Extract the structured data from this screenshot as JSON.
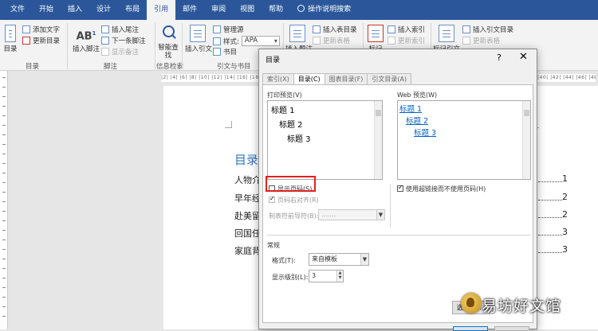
{
  "ribbon_tabs": [
    "文件",
    "开始",
    "插入",
    "设计",
    "布局",
    "引用",
    "邮件",
    "审阅",
    "视图",
    "帮助"
  ],
  "active_tab_index": 5,
  "tell_me": "操作说明搜索",
  "ribbon": {
    "toc_button": "目录",
    "add_text": "添加文字",
    "update_toc": "更新目录",
    "group_toc": "目录",
    "insert_footnote": "插入脚注",
    "insert_endnote": "插入尾注",
    "next_footnote": "下一条脚注",
    "show_notes": "显示备注",
    "group_footnotes": "脚注",
    "smart_lookup": "智能查找",
    "group_research": "信息检索",
    "insert_citation": "插入引文",
    "manage_sources": "管理源",
    "style_label": "样式:",
    "style_value": "APA",
    "bibliography": "书目",
    "group_citations": "引文与书目",
    "insert_caption": "插入题注",
    "insert_table_of_figures": "插入表目录",
    "update_table": "更新表格",
    "mark_entry": "标记",
    "insert_index": "插入索引",
    "update_index": "更新索引",
    "mark_citation": "标记引文",
    "insert_table_of_authorities": "插入引文目录",
    "update_table2": "更新表格"
  },
  "ruler_text": "|2| |4| |6| |8| |10| |12| |14| |16| |18|",
  "ruler_text_right": "|40| |42| |44| |46| |48|",
  "document": {
    "toc_title": "目录",
    "entries": [
      {
        "text": "人物介",
        "page": "1"
      },
      {
        "text": "早年经",
        "page": "2"
      },
      {
        "text": "赴美留",
        "page": "2"
      },
      {
        "text": "回国任",
        "page": "3"
      },
      {
        "text": "家庭背",
        "page": "3"
      }
    ]
  },
  "dialog": {
    "title": "目录",
    "help": "?",
    "close": "✕",
    "tabs": [
      "索引(X)",
      "目录(C)",
      "图表目录(F)",
      "引文目录(A)"
    ],
    "active_tab_index": 1,
    "print_preview_label": "打印预览(V)",
    "print_preview_items": [
      "标题 1",
      "标题 2",
      "标题 3"
    ],
    "web_preview_label": "Web 预览(W)",
    "web_preview_items": [
      "标题 1",
      "标题 2",
      "标题 3"
    ],
    "show_page_numbers": "显示页码(S)",
    "show_page_numbers_checked": false,
    "right_align": "页码右对齐(R)",
    "tab_leader_label": "制表符前导符(B):",
    "tab_leader_value": ".......",
    "use_hyperlinks": "使用超链接而不使用页码(H)",
    "use_hyperlinks_checked": true,
    "general_label": "常规",
    "formats_label": "格式(T):",
    "formats_value": "来自模板",
    "levels_label": "显示级别(L):",
    "levels_value": "3",
    "options_button": "选项(O)..."
  },
  "watermark": "易坊好文馆"
}
